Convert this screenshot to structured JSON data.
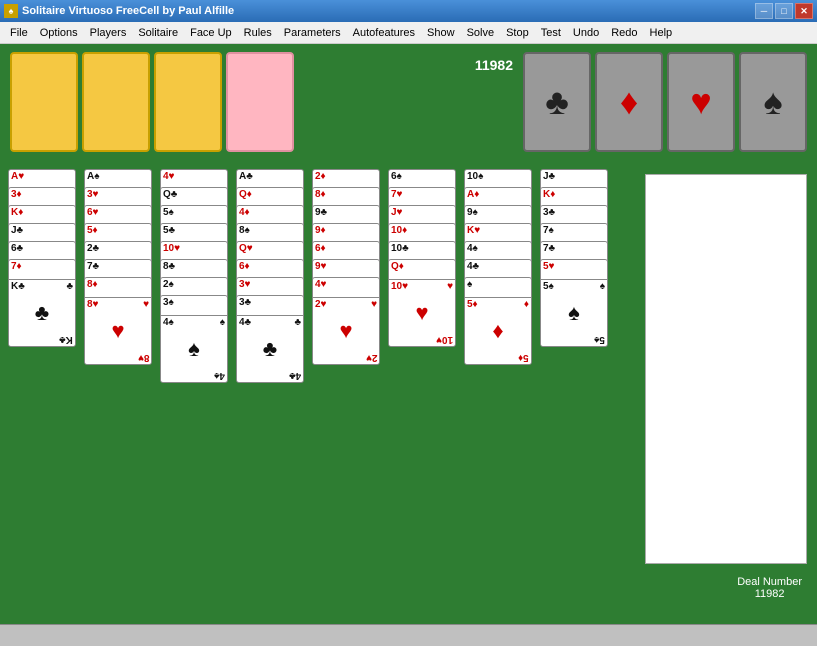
{
  "titleBar": {
    "title": "Solitaire Virtuoso    FreeCell    by Paul Alfille",
    "minimizeLabel": "─",
    "maximizeLabel": "□",
    "closeLabel": "✕"
  },
  "menuBar": {
    "items": [
      "File",
      "Options",
      "Players",
      "Solitaire",
      "Face Up",
      "Rules",
      "Parameters",
      "Autofeatures",
      "Show",
      "Solve",
      "Stop",
      "Test",
      "Undo",
      "Redo",
      "Help"
    ]
  },
  "score": "11982",
  "dealInfo": {
    "label": "Deal Number",
    "number": "11982"
  },
  "foundations": [
    {
      "suit": "♣",
      "color": "black",
      "name": "clubs"
    },
    {
      "suit": "♦",
      "color": "red",
      "name": "diamonds"
    },
    {
      "suit": "♥",
      "color": "red",
      "name": "hearts"
    },
    {
      "suit": "♠",
      "color": "black",
      "name": "spades"
    }
  ],
  "freeCells": [
    {
      "color": "yellow"
    },
    {
      "color": "yellow"
    },
    {
      "color": "yellow"
    },
    {
      "color": "pink"
    }
  ],
  "columns": [
    {
      "cards": [
        {
          "rank": "A",
          "suit": "♥",
          "color": "red"
        },
        {
          "rank": "3",
          "suit": "♦",
          "color": "red"
        },
        {
          "rank": "K",
          "suit": "♦",
          "color": "red"
        },
        {
          "rank": "J",
          "suit": "♣",
          "color": "black"
        },
        {
          "rank": "6",
          "suit": "♣",
          "color": "black"
        },
        {
          "rank": "7",
          "suit": "♦",
          "color": "red"
        },
        {
          "rank": "K",
          "suit": "♣",
          "color": "black"
        }
      ]
    },
    {
      "cards": [
        {
          "rank": "A",
          "suit": "♠",
          "color": "black"
        },
        {
          "rank": "3",
          "suit": "♥",
          "color": "red"
        },
        {
          "rank": "6",
          "suit": "♥",
          "color": "red"
        },
        {
          "rank": "5",
          "suit": "♦",
          "color": "red"
        },
        {
          "rank": "2",
          "suit": "♣",
          "color": "black"
        },
        {
          "rank": "7",
          "suit": "♣",
          "color": "black"
        },
        {
          "rank": "8",
          "suit": "♦",
          "color": "red"
        },
        {
          "rank": "8",
          "suit": "♥",
          "color": "red"
        }
      ]
    },
    {
      "cards": [
        {
          "rank": "4",
          "suit": "♥",
          "color": "red"
        },
        {
          "rank": "Q",
          "suit": "♣",
          "color": "black"
        },
        {
          "rank": "5",
          "suit": "♠",
          "color": "black"
        },
        {
          "rank": "5",
          "suit": "♣",
          "color": "black"
        },
        {
          "rank": "10",
          "suit": "♥",
          "color": "red"
        },
        {
          "rank": "8",
          "suit": "♣",
          "color": "black"
        },
        {
          "rank": "2",
          "suit": "♠",
          "color": "black"
        },
        {
          "rank": "3",
          "suit": "♠",
          "color": "black"
        },
        {
          "rank": "4",
          "suit": "♠",
          "color": "black"
        }
      ]
    },
    {
      "cards": [
        {
          "rank": "A",
          "suit": "♣",
          "color": "black"
        },
        {
          "rank": "Q",
          "suit": "♦",
          "color": "red"
        },
        {
          "rank": "4",
          "suit": "♦",
          "color": "red"
        },
        {
          "rank": "8",
          "suit": "♠",
          "color": "black"
        },
        {
          "rank": "Q",
          "suit": "♥",
          "color": "red"
        },
        {
          "rank": "6",
          "suit": "♦",
          "color": "red"
        },
        {
          "rank": "3",
          "suit": "♥",
          "color": "red"
        },
        {
          "rank": "3",
          "suit": "♣",
          "color": "black"
        },
        {
          "rank": "4",
          "suit": "♣",
          "color": "black"
        }
      ]
    },
    {
      "cards": [
        {
          "rank": "2",
          "suit": "♦",
          "color": "red"
        },
        {
          "rank": "8",
          "suit": "♦",
          "color": "red"
        },
        {
          "rank": "9",
          "suit": "♣",
          "color": "black"
        },
        {
          "rank": "9",
          "suit": "♦",
          "color": "red"
        },
        {
          "rank": "6",
          "suit": "♦",
          "color": "red"
        },
        {
          "rank": "9",
          "suit": "♥",
          "color": "red"
        },
        {
          "rank": "4",
          "suit": "♥",
          "color": "red"
        },
        {
          "rank": "2",
          "suit": "♥",
          "color": "red"
        }
      ]
    },
    {
      "cards": [
        {
          "rank": "6",
          "suit": "♠",
          "color": "black"
        },
        {
          "rank": "7",
          "suit": "♥",
          "color": "red"
        },
        {
          "rank": "J",
          "suit": "♥",
          "color": "red"
        },
        {
          "rank": "10",
          "suit": "♦",
          "color": "red"
        },
        {
          "rank": "10",
          "suit": "♣",
          "color": "black"
        },
        {
          "rank": "Q",
          "suit": "♦",
          "color": "red"
        },
        {
          "rank": "10",
          "suit": "♥",
          "color": "red"
        }
      ]
    },
    {
      "cards": [
        {
          "rank": "10",
          "suit": "♠",
          "color": "black"
        },
        {
          "rank": "A",
          "suit": "♦",
          "color": "red"
        },
        {
          "rank": "9",
          "suit": "♠",
          "color": "black"
        },
        {
          "rank": "K",
          "suit": "♥",
          "color": "red"
        },
        {
          "rank": "4",
          "suit": "♠",
          "color": "black"
        },
        {
          "rank": "4",
          "suit": "♣",
          "color": "black"
        },
        {
          "rank": "♠",
          "suit": "",
          "color": "black"
        },
        {
          "rank": "5",
          "suit": "♦",
          "color": "red"
        }
      ]
    },
    {
      "cards": [
        {
          "rank": "J",
          "suit": "♣",
          "color": "black"
        },
        {
          "rank": "K",
          "suit": "♦",
          "color": "red"
        },
        {
          "rank": "3",
          "suit": "♣",
          "color": "black"
        },
        {
          "rank": "7",
          "suit": "♠",
          "color": "black"
        },
        {
          "rank": "7",
          "suit": "♣",
          "color": "black"
        },
        {
          "rank": "5",
          "suit": "♥",
          "color": "red"
        },
        {
          "rank": "5",
          "suit": "♠",
          "color": "black"
        }
      ]
    }
  ]
}
